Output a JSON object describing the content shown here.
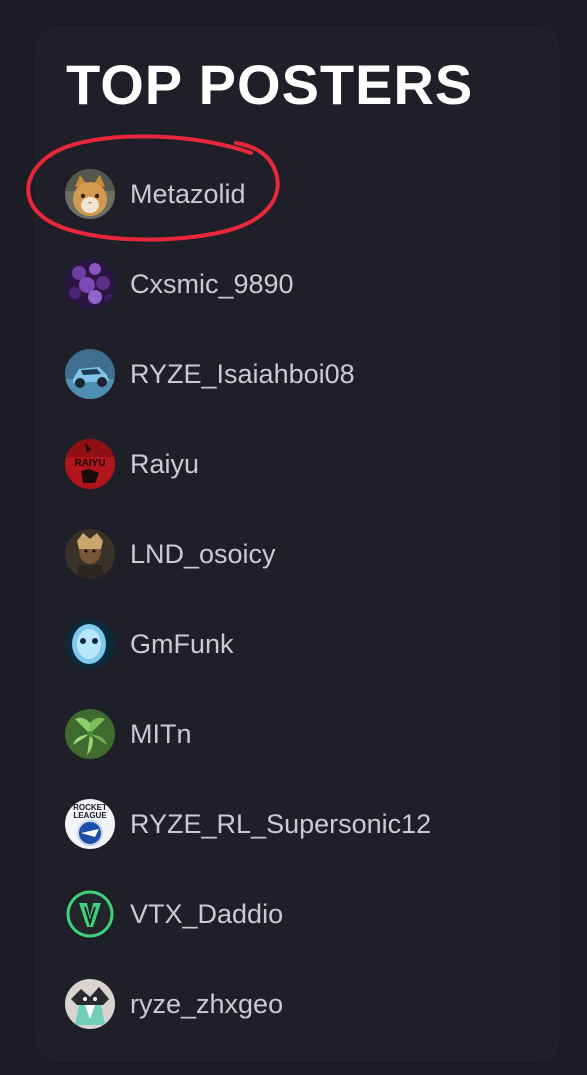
{
  "widget": {
    "title": "TOP POSTERS"
  },
  "posters": [
    {
      "username": "Metazolid",
      "avatar_icon": "cat-avatar-icon",
      "highlighted": true
    },
    {
      "username": "Cxsmic_9890",
      "avatar_icon": "purple-flowers-avatar-icon"
    },
    {
      "username": "RYZE_Isaiahboi08",
      "avatar_icon": "rocket-car-avatar-icon"
    },
    {
      "username": "Raiyu",
      "avatar_icon": "raiyu-logo-avatar-icon",
      "avatar_text": "RAIYU"
    },
    {
      "username": "LND_osoicy",
      "avatar_icon": "person-portrait-avatar-icon"
    },
    {
      "username": "GmFunk",
      "avatar_icon": "blue-face-avatar-icon"
    },
    {
      "username": "MITn",
      "avatar_icon": "green-plant-avatar-icon"
    },
    {
      "username": "RYZE_RL_Supersonic12",
      "avatar_icon": "rocket-league-logo-avatar-icon",
      "avatar_text": "ROCKET LEAGUE"
    },
    {
      "username": "VTX_Daddio",
      "avatar_icon": "vtx-logo-avatar-icon"
    },
    {
      "username": "ryze_zhxgeo",
      "avatar_icon": "character-avatar-icon"
    }
  ],
  "colors": {
    "background": "#1c1d24",
    "panel": "#1e1f28",
    "title": "#ffffff",
    "username": "#c9cad3",
    "highlight_circle": "#e8283a"
  }
}
